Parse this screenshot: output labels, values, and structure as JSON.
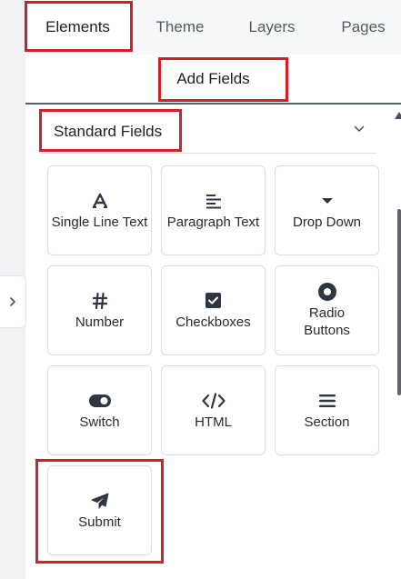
{
  "tabs": [
    {
      "label": "Elements",
      "active": true
    },
    {
      "label": "Theme",
      "active": false
    },
    {
      "label": "Layers",
      "active": false
    },
    {
      "label": "Pages",
      "active": false
    }
  ],
  "subheader": {
    "label": "Add Fields"
  },
  "section": {
    "title": "Standard Fields",
    "expanded": true
  },
  "fields": [
    {
      "label": "Single Line Text",
      "icon": "text-a-icon"
    },
    {
      "label": "Paragraph Text",
      "icon": "paragraph-icon"
    },
    {
      "label": "Drop Down",
      "icon": "dropdown-caret-icon"
    },
    {
      "label": "Number",
      "icon": "hash-icon"
    },
    {
      "label": "Checkboxes",
      "icon": "checkbox-icon"
    },
    {
      "label": "Radio Buttons",
      "icon": "radio-icon"
    },
    {
      "label": "Switch",
      "icon": "toggle-icon"
    },
    {
      "label": "HTML",
      "icon": "code-icon"
    },
    {
      "label": "Section",
      "icon": "section-lines-icon"
    },
    {
      "label": "Submit",
      "icon": "paper-plane-icon"
    }
  ],
  "colors": {
    "highlight": "#d32027",
    "icon": "#2f3640",
    "card_border": "#d9dce1"
  }
}
